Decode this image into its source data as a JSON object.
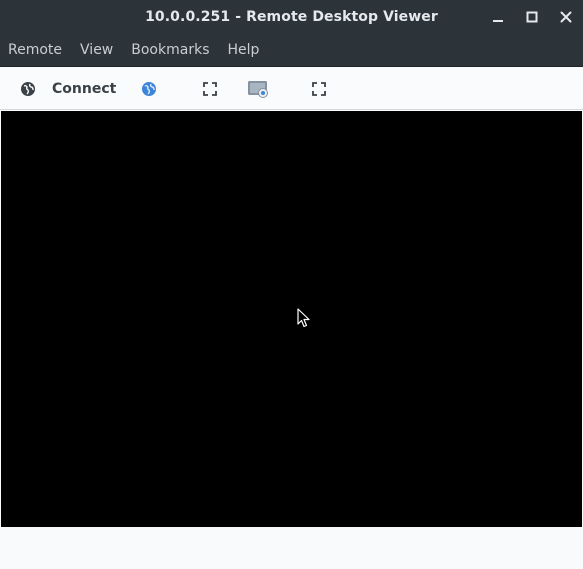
{
  "window": {
    "title": "10.0.0.251 - Remote Desktop Viewer"
  },
  "menubar": {
    "items": [
      {
        "label": "Remote"
      },
      {
        "label": "View"
      },
      {
        "label": "Bookmarks"
      },
      {
        "label": "Help"
      }
    ]
  },
  "toolbar": {
    "connect_label": "Connect",
    "icons": [
      "network-icon",
      "globe-icon",
      "fullscreen-icon",
      "screenshot-icon",
      "fit-window-icon"
    ]
  },
  "colors": {
    "titlebar": "#2c3339",
    "viewer_background": "#000000",
    "accent_blue": "#3d85d8"
  }
}
